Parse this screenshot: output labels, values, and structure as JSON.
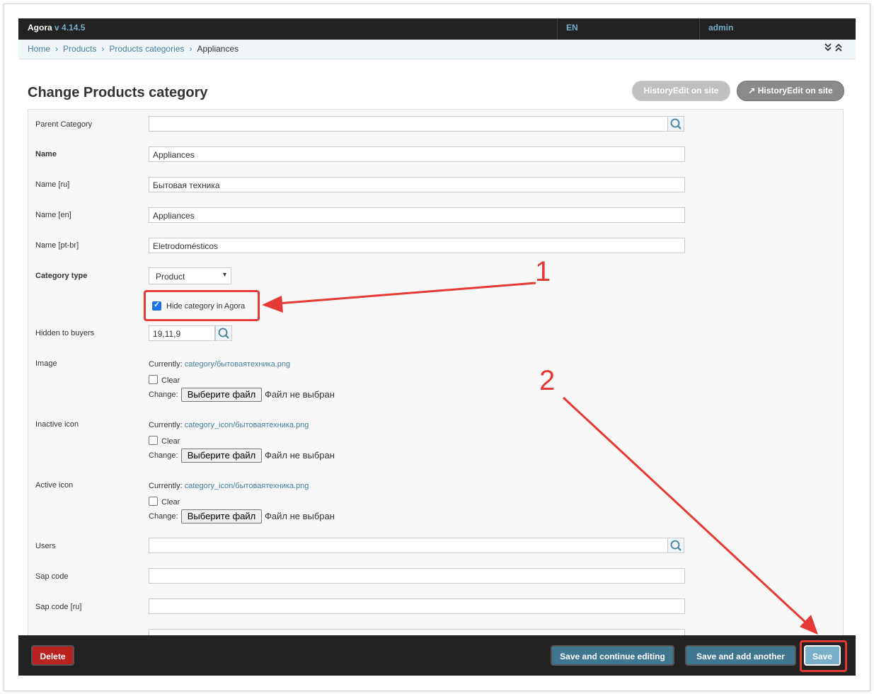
{
  "header": {
    "brand": "Agora",
    "version": "v 4.14.5",
    "language": "EN",
    "user": "admin"
  },
  "breadcrumb": {
    "home": "Home",
    "products": "Products",
    "categories": "Products categories",
    "current": "Appliances",
    "toggles": "»«"
  },
  "page": {
    "title": "Change Products category",
    "history_btn_disabled": "HistoryEdit on site",
    "history_btn": "HistoryEdit on site"
  },
  "form": {
    "parent_category": {
      "label": "Parent Category",
      "value": ""
    },
    "name": {
      "label": "Name",
      "value": "Appliances"
    },
    "name_ru": {
      "label": "Name [ru]",
      "value": "Бытовая техника"
    },
    "name_en": {
      "label": "Name [en]",
      "value": "Appliances"
    },
    "name_ptbr": {
      "label": "Name [pt-br]",
      "value": "Eletrodomésticos"
    },
    "category_type": {
      "label": "Category type",
      "value": "Product"
    },
    "hide_category": {
      "label": "Hide category in Agora",
      "checked": true
    },
    "hidden_to_buyers": {
      "label": "Hidden to buyers",
      "value": "19,11,9"
    },
    "image": {
      "label": "Image",
      "currently": "Currently:",
      "link": "category/бытоваятехника.png",
      "clear": "Clear",
      "change": "Change:",
      "button": "Выберите файл",
      "nofile": "Файл не выбран"
    },
    "inactive_icon": {
      "label": "Inactive icon",
      "currently": "Currently:",
      "link": "category_icon/бытоваятехника.png",
      "clear": "Clear",
      "change": "Change:",
      "button": "Выберите файл",
      "nofile": "Файл не выбран"
    },
    "active_icon": {
      "label": "Active icon",
      "currently": "Currently:",
      "link": "category_icon/бытоваятехника.png",
      "clear": "Clear",
      "change": "Change:",
      "button": "Выберите файл",
      "nofile": "Файл не выбран"
    },
    "users": {
      "label": "Users",
      "value": ""
    },
    "sap_code": {
      "label": "Sap code",
      "value": ""
    },
    "sap_code_ru": {
      "label": "Sap code [ru]",
      "value": ""
    }
  },
  "footer": {
    "delete": "Delete",
    "save_continue": "Save and continue editing",
    "save_add": "Save and add another",
    "save": "Save"
  },
  "annotations": {
    "one": "1",
    "two": "2"
  },
  "colors": {
    "accent": "#79aec8",
    "link": "#447e9b",
    "danger": "#ba2121",
    "annotation": "#e53935"
  }
}
